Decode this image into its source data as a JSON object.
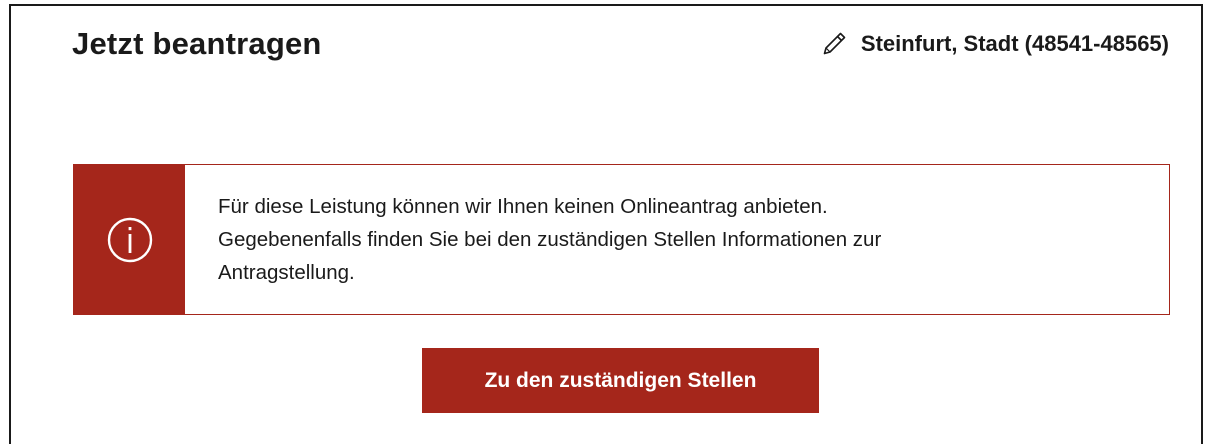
{
  "header": {
    "title": "Jetzt beantragen",
    "location_label": "Steinfurt, Stadt (48541-48565)",
    "location_icon": "pencil-icon"
  },
  "alert": {
    "icon": "info-icon",
    "line1": "Für diese Leistung können wir Ihnen keinen Onlineantrag anbieten.",
    "line2": "Gegebenenfalls finden Sie bei den zuständigen Stellen Informationen zur",
    "line3": "Antragstellung."
  },
  "actions": {
    "primary_label": "Zu den zuständigen Stellen"
  },
  "colors": {
    "accent": "#a5261b",
    "text": "#1a1a1a",
    "background": "#ffffff"
  }
}
